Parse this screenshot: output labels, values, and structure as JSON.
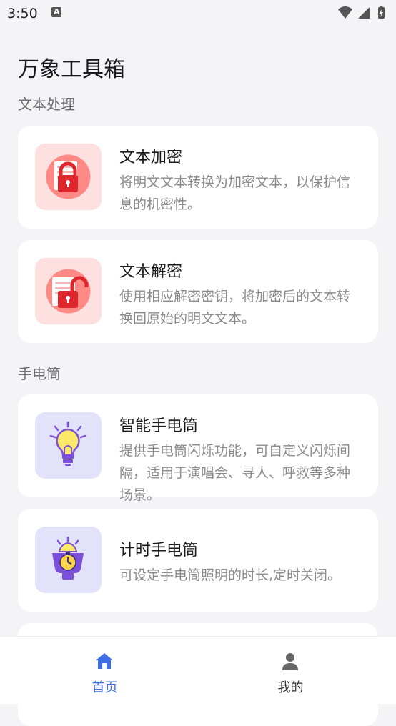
{
  "status_bar": {
    "time": "3:50",
    "notification_glyph": "A"
  },
  "app_title": "万象工具箱",
  "sections": [
    {
      "title": "文本处理",
      "cards": [
        {
          "title": "文本加密",
          "description": "将明文文本转换为加密文本，以保护信息的机密性。",
          "icon": "lock-closed-icon"
        },
        {
          "title": "文本解密",
          "description": "使用相应解密密钥，将加密后的文本转换回原始的明文文本。",
          "icon": "lock-open-icon"
        }
      ]
    },
    {
      "title": "手电筒",
      "cards": [
        {
          "title": "智能手电筒",
          "description": "提供手电筒闪烁功能，可自定义闪烁间隔，适用于演唱会、寻人、呼救等多种场景。",
          "icon": "lightbulb-icon"
        },
        {
          "title": "计时手电筒",
          "description": "可设定手电筒照明的时长,定时关闭。",
          "icon": "timer-bulb-icon"
        }
      ]
    }
  ],
  "bottom_nav": [
    {
      "label": "首页",
      "icon": "home-icon",
      "active": true
    },
    {
      "label": "我的",
      "icon": "person-icon",
      "active": false
    }
  ],
  "colors": {
    "accent": "#3d6ee8",
    "lock_card_bg": "#ffe0e0",
    "flashlight_card_bg": "#e3e2fb",
    "lock_red": "#e0262d",
    "bulb_yellow": "#fbe96a",
    "bulb_purple": "#7b4fd9"
  }
}
